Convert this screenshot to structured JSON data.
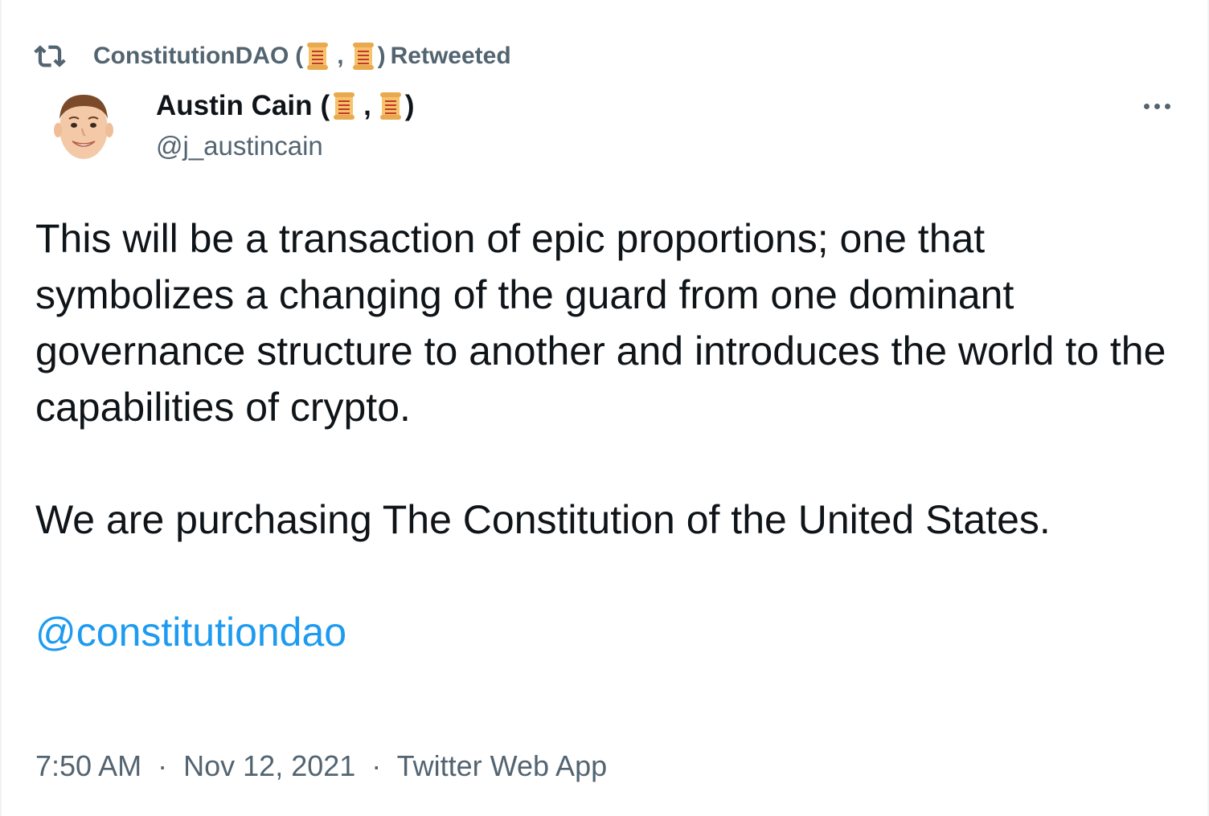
{
  "retweet": {
    "icon": "retweet-icon",
    "account": "ConstitutionDAO",
    "open_paren": "(",
    "comma": ",",
    "close_paren": ")",
    "label": "Retweeted"
  },
  "author": {
    "name": "Austin Cain",
    "open_paren": "(",
    "comma": ",",
    "close_paren": ")",
    "handle": "@j_austincain",
    "name_emoji": "scroll-icon"
  },
  "tweet": {
    "paragraph_1": "This will be a transaction of epic proportions; one that symbolizes a changing of the guard from one dominant governance structure to another and introduces the world to the capabilities of crypto.",
    "paragraph_2": "We are purchasing The Constitution of the United States.",
    "mention": "@constitutiondao"
  },
  "meta": {
    "time": "7:50 AM",
    "separator": "·",
    "date": "Nov 12, 2021",
    "source": "Twitter Web App"
  },
  "colors": {
    "text": "#0f1419",
    "secondary": "#536471",
    "link": "#1d9bf0"
  }
}
